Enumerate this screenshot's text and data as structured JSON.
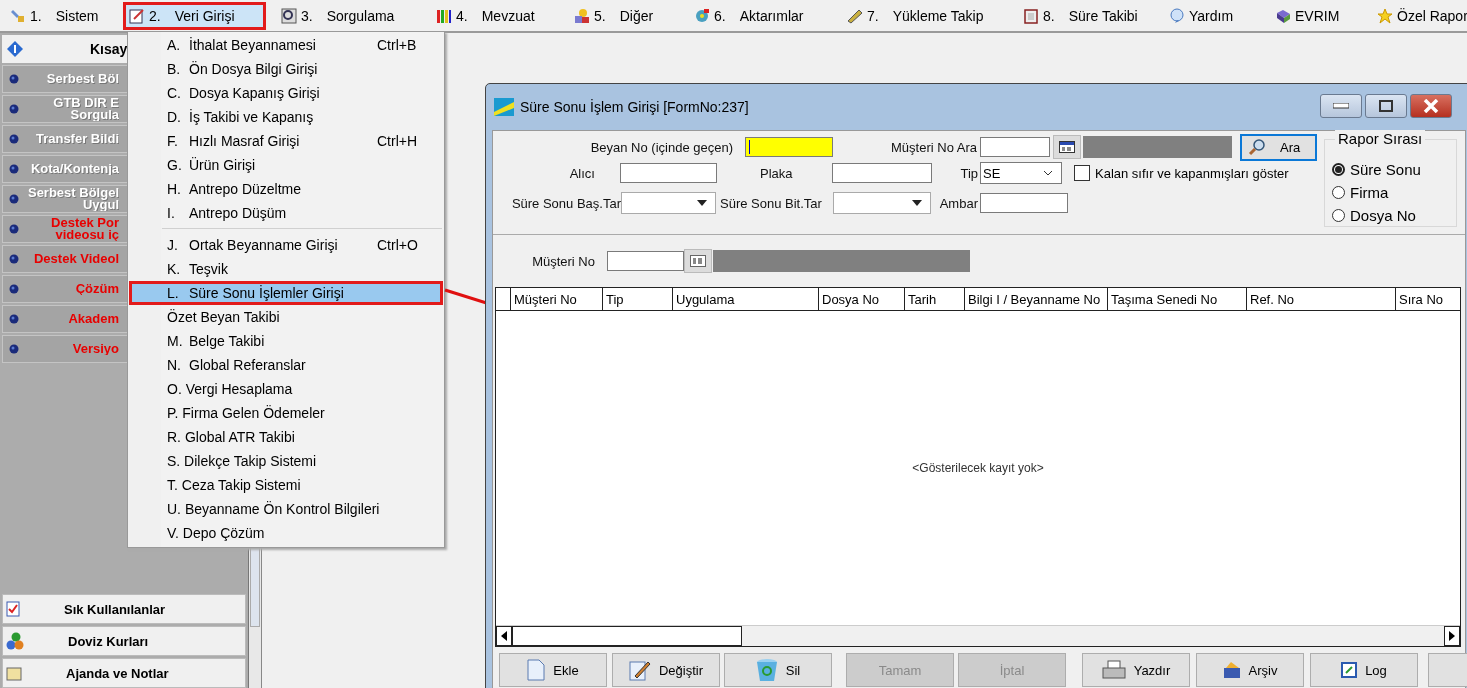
{
  "menu_bar": [
    {
      "number": "1.",
      "label": "Sistem",
      "selected": false
    },
    {
      "number": "2.",
      "label": "Veri Girişi",
      "selected": true
    },
    {
      "number": "3.",
      "label": "Sorgulama",
      "selected": false
    },
    {
      "number": "4.",
      "label": "Mevzuat",
      "selected": false
    },
    {
      "number": "5.",
      "label": "Diğer",
      "selected": false
    },
    {
      "number": "6.",
      "label": "Aktarımlar",
      "selected": false
    },
    {
      "number": "7.",
      "label": "Yükleme Takip",
      "selected": false
    },
    {
      "number": "8.",
      "label": "Süre Takibi",
      "selected": false
    },
    {
      "label": "Yardım",
      "selected": false
    },
    {
      "label": "EVRIM",
      "selected": false
    },
    {
      "label": "Özel Rapor",
      "selected": false
    }
  ],
  "sidebar": {
    "header": "Kısay",
    "items": [
      {
        "lines": [
          "Serbest Böl"
        ],
        "kind": "normal"
      },
      {
        "lines": [
          "GTB DIR E",
          "Sorgula"
        ],
        "kind": "normal"
      },
      {
        "lines": [
          "Transfer Bildi"
        ],
        "kind": "normal"
      },
      {
        "lines": [
          "Kota/Kontenja"
        ],
        "kind": "normal"
      },
      {
        "lines": [
          "Serbest Bölgel",
          "Uygul"
        ],
        "kind": "normal"
      },
      {
        "lines": [
          "Destek Por",
          "videosu iç"
        ],
        "kind": "highlight"
      },
      {
        "lines": [
          "Destek Videol"
        ],
        "kind": "highlight"
      },
      {
        "lines": [
          "Çözüm"
        ],
        "kind": "highlight"
      },
      {
        "lines": [
          "Akadem"
        ],
        "kind": "highlight"
      },
      {
        "lines": [
          "Versiyo"
        ],
        "kind": "highlight"
      }
    ],
    "bottom_buttons": [
      "Sık Kullanılanlar",
      "Doviz Kurları",
      "Ajanda ve Notlar"
    ]
  },
  "dropdown_menu": [
    {
      "kind": "item",
      "key": "A.",
      "label": "İthalat Beyannamesi",
      "shortcut": "Ctrl+B",
      "selected": false
    },
    {
      "kind": "item",
      "key": "B.",
      "label": "Ön Dosya Bilgi Girişi",
      "selected": false
    },
    {
      "kind": "item",
      "key": "C.",
      "label": "Dosya Kapanış Girişi",
      "selected": false
    },
    {
      "kind": "item",
      "key": "D.",
      "label": "İş Takibi ve Kapanış",
      "selected": false
    },
    {
      "kind": "item",
      "key": "F.",
      "label": "Hızlı Masraf Girişi",
      "shortcut": "Ctrl+H",
      "selected": false
    },
    {
      "kind": "item",
      "key": "G.",
      "label": "Ürün Girişi",
      "selected": false
    },
    {
      "kind": "item",
      "key": "H.",
      "label": "Antrepo Düzeltme",
      "selected": false
    },
    {
      "kind": "item",
      "key": "I.",
      "label": "Antrepo Düşüm",
      "selected": false
    },
    {
      "kind": "separator"
    },
    {
      "kind": "item",
      "key": "J.",
      "label": "Ortak Beyanname Girişi",
      "shortcut": "Ctrl+O",
      "selected": false
    },
    {
      "kind": "item",
      "key": "K.",
      "label": "Teşvik",
      "selected": false
    },
    {
      "kind": "item",
      "key": "L.",
      "label": "Süre Sonu İşlemler Girişi",
      "selected": true
    },
    {
      "kind": "item",
      "label": "Özet Beyan Takibi",
      "selected": false
    },
    {
      "kind": "item",
      "key": "M.",
      "label": "Belge Takibi",
      "selected": false
    },
    {
      "kind": "item",
      "key": "N.",
      "label": "Global Referanslar",
      "selected": false
    },
    {
      "kind": "item",
      "label": "O. Vergi Hesaplama",
      "selected": false
    },
    {
      "kind": "item",
      "label": "P. Firma Gelen Ödemeler",
      "selected": false
    },
    {
      "kind": "item",
      "label": "R. Global ATR Takibi",
      "selected": false
    },
    {
      "kind": "item",
      "label": "S. Dilekçe Takip Sistemi",
      "selected": false
    },
    {
      "kind": "item",
      "label": "T. Ceza Takip Sistemi",
      "selected": false
    },
    {
      "kind": "item",
      "label": "U. Beyanname Ön Kontrol Bilgileri",
      "selected": false
    },
    {
      "kind": "item",
      "label": "V. Depo Çözüm",
      "selected": false
    }
  ],
  "window": {
    "title": "Süre Sonu İşlem Girişi [FormNo:237]",
    "form": {
      "beyan_no": {
        "label": "Beyan No (içinde geçen)"
      },
      "musteri_no_ara": {
        "label": "Müşteri No Ara"
      },
      "search_button": "Ara",
      "alici": {
        "label": "Alıcı"
      },
      "plaka": {
        "label": "Plaka"
      },
      "tip": {
        "label": "Tip",
        "value": "SE"
      },
      "kalan_sifir": {
        "label": "Kalan sıfır ve kapanmışları göster",
        "checked": false
      },
      "sure_sonu_bas": {
        "label": "Süre Sonu Baş.Tar"
      },
      "sure_sonu_bit": {
        "label": "Süre Sonu Bit.Tar"
      },
      "ambar": {
        "label": "Ambar"
      },
      "musteri_no": {
        "label": "Müşteri No"
      }
    },
    "rapor_sirasi": {
      "title": "Rapor Sırası",
      "options": [
        {
          "label": "Süre Sonu",
          "selected": true
        },
        {
          "label": "Firma",
          "selected": false
        },
        {
          "label": "Dosya No",
          "selected": false
        }
      ]
    },
    "table": {
      "columns": [
        "Müşteri No",
        "Tip",
        "Uygulama",
        "Dosya No",
        "Tarih",
        "Bilgi I / Beyanname No",
        "Taşıma Senedi No",
        "Ref. No",
        "Sıra No"
      ],
      "empty_text": "<Gösterilecek kayıt yok>"
    },
    "buttons": [
      {
        "label": "Ekle",
        "disabled": false
      },
      {
        "label": "Değiştir",
        "disabled": false
      },
      {
        "label": "Sil",
        "disabled": false
      },
      {
        "label": "Tamam",
        "disabled": true
      },
      {
        "label": "İptal",
        "disabled": true
      },
      {
        "label": "Yazdır",
        "disabled": false
      },
      {
        "label": "Arşiv",
        "disabled": false
      },
      {
        "label": "Log",
        "disabled": false
      }
    ]
  }
}
